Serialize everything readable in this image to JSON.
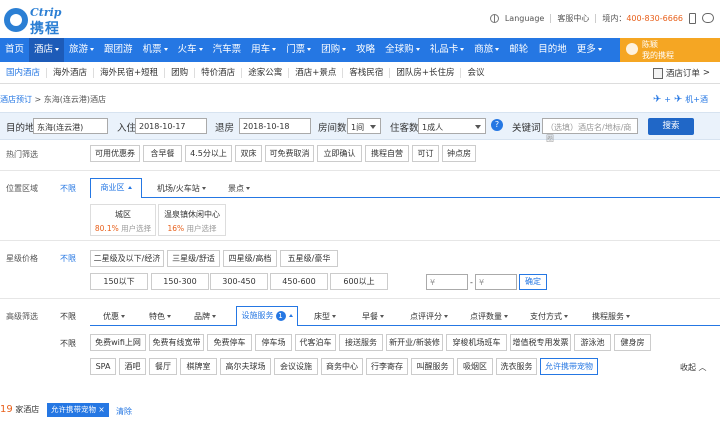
{
  "header": {
    "brand_en": "Ctrip",
    "brand_cn": "携程",
    "language": "Language",
    "service": "客服中心",
    "hotline_label": "境内：",
    "hotline": "400-830-6666"
  },
  "nav": {
    "items": [
      "首页",
      "酒店",
      "旅游",
      "跟团游",
      "机票",
      "火车",
      "汽车票",
      "用车",
      "门票",
      "团购",
      "攻略",
      "全球购",
      "礼品卡",
      "商旅",
      "邮轮",
      "目的地",
      "更多"
    ],
    "has_caret": [
      false,
      true,
      true,
      false,
      true,
      true,
      false,
      true,
      true,
      true,
      false,
      true,
      true,
      true,
      false,
      false,
      true
    ],
    "user_name": "陈颖",
    "my_ctrip": "我的携程"
  },
  "subnav": {
    "items": [
      "国内酒店",
      "海外酒店",
      "海外民宿+短租",
      "团购",
      "特价酒店",
      "途家公寓",
      "酒店+景点",
      "客栈民宿",
      "团队房+长住房",
      "会议"
    ],
    "orders": "酒店订单"
  },
  "breadcrumb": {
    "parent": "酒店预订",
    "sep": ">",
    "current": "东海(连云港)酒店",
    "air_hotel": "机+酒"
  },
  "search": {
    "dest_label": "目的地",
    "dest_value": "东海(连云港)",
    "checkin_label": "入住",
    "checkin_value": "2018-10-17",
    "checkout_label": "退房",
    "checkout_value": "2018-10-18",
    "rooms_label": "房间数",
    "rooms_value": "1间",
    "guests_label": "住客数",
    "guests_value": "1成人",
    "keyword_label": "关键词",
    "keyword_placeholder": "（选填）酒店名/地标/商圈",
    "button": "搜索",
    "help": "?"
  },
  "hot": {
    "label": "热门筛选",
    "chips": [
      "可用优惠券",
      "含早餐",
      "4.5分以上",
      "双床",
      "可免费取消",
      "立即确认",
      "携程自营",
      "可订",
      "钟点房"
    ]
  },
  "location": {
    "label": "位置区域",
    "all": "不限",
    "tabs": [
      "商业区",
      "机场/火车站",
      "景点"
    ],
    "districts": [
      {
        "name": "城区",
        "pct": "80.1%",
        "text": " 用户选择"
      },
      {
        "name": "温泉镇休闲中心",
        "pct": "16%",
        "text": " 用户选择"
      }
    ]
  },
  "star": {
    "label": "星级价格",
    "all": "不限",
    "levels": [
      "二星级及以下/经济",
      "三星级/舒适",
      "四星级/高档",
      "五星级/豪华"
    ],
    "prices": [
      "150以下",
      "150-300",
      "300-450",
      "450-600",
      "600以上"
    ],
    "min_symbol": "¥",
    "max_symbol": "¥",
    "dash": "-",
    "ok": "确定"
  },
  "advanced": {
    "label": "高级筛选",
    "all": "不限",
    "tabs": [
      "优惠",
      "特色",
      "品牌",
      "设施服务",
      "床型",
      "早餐",
      "点评评分",
      "点评数量",
      "支付方式",
      "携程服务"
    ],
    "facility_count": "1",
    "all2": "不限",
    "facilities_row1": [
      "免费wifi上网",
      "免费有线宽带",
      "免费停车",
      "停车场",
      "代客泊车",
      "接送服务",
      "新开业/新装修",
      "穿梭机场班车",
      "增值税专用发票",
      "游泳池",
      "健身房"
    ],
    "facilities_row2": [
      "SPA",
      "酒吧",
      "餐厅",
      "棋牌室",
      "高尔夫球场",
      "会议设施",
      "商务中心",
      "行李寄存",
      "叫醒服务",
      "吸烟区",
      "洗衣服务",
      "允许携带宠物"
    ],
    "collapse": "收起"
  },
  "results": {
    "count": "19",
    "suffix": "家酒店",
    "tag": "允许携带宠物 ×",
    "clear": "清除"
  }
}
